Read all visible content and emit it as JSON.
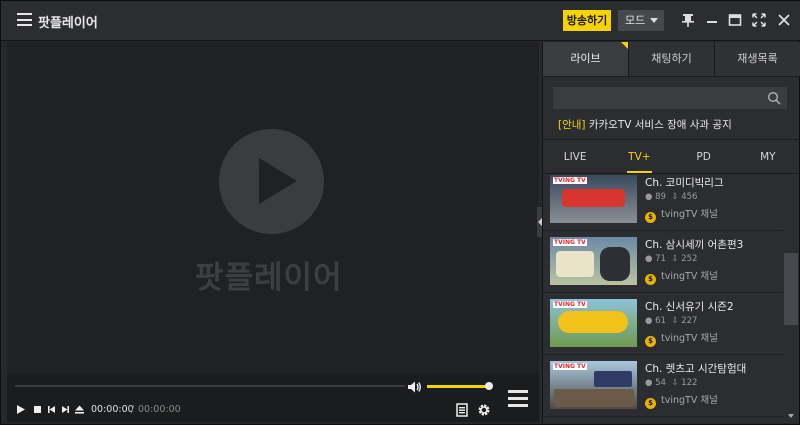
{
  "app": {
    "title": "팟플레이어"
  },
  "toolbar": {
    "broadcast_label": "방송하기",
    "mode_label": "모드"
  },
  "player": {
    "logo_text": "팟플레이어",
    "current_time": "00:00:00",
    "separator": "/",
    "total_time": "00:00:00",
    "volume": 1.0
  },
  "panel": {
    "tabs": [
      "라이브",
      "채팅하기",
      "재생목록"
    ],
    "search_placeholder": "",
    "notice_tag": "[안내]",
    "notice_text": "카카오TV 서비스 장애 사과 공지",
    "sub_tabs": [
      "LIVE",
      "TV+",
      "PD",
      "MY"
    ],
    "items": [
      {
        "title": "Ch. 코미디빅리그",
        "viewers": "89",
        "likes": "456",
        "channel": "tvingTV 채널",
        "thumb_logo": "TVING TV"
      },
      {
        "title": "Ch. 삼시세끼 어촌편3",
        "viewers": "71",
        "likes": "252",
        "channel": "tvingTV 채널",
        "thumb_logo": "TVING TV"
      },
      {
        "title": "Ch. 신서유기 시즌2",
        "viewers": "61",
        "likes": "227",
        "channel": "tvingTV 채널",
        "thumb_logo": "TVING TV"
      },
      {
        "title": "Ch. 렛츠고 시간탐험대",
        "viewers": "54",
        "likes": "122",
        "channel": "tvingTV 채널",
        "thumb_logo": "TVING TV"
      }
    ]
  },
  "colors": {
    "accent": "#f5d400",
    "background": "#26282b",
    "panel": "#2b2d30"
  }
}
